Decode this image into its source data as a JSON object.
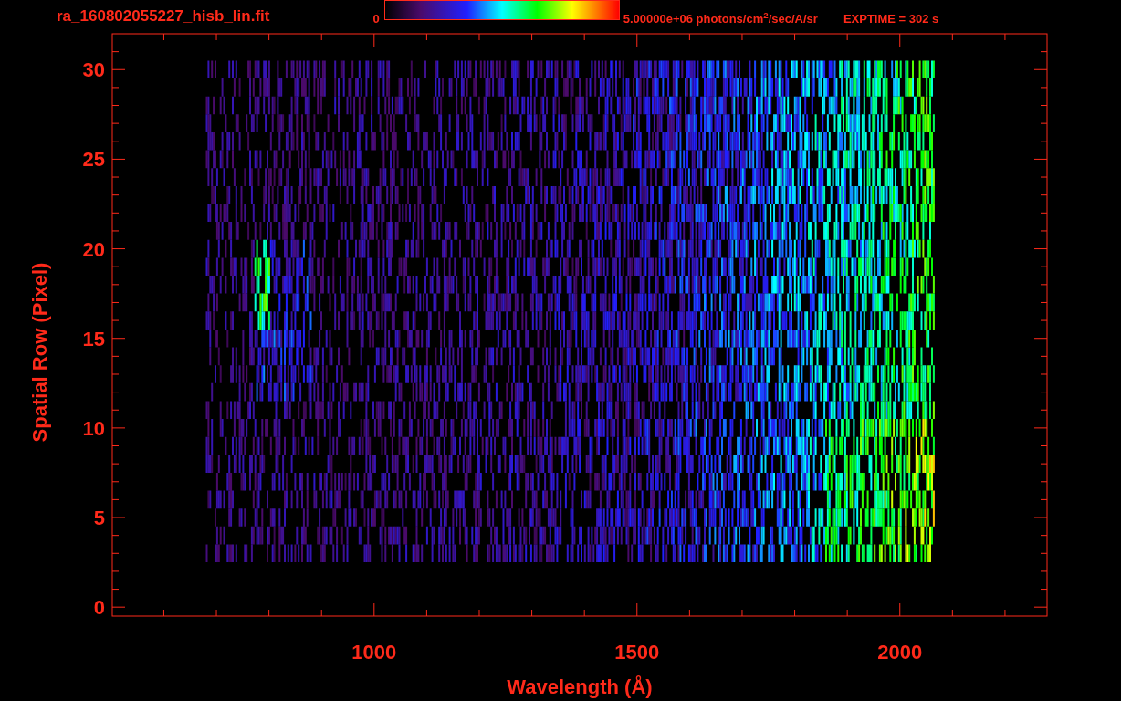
{
  "header": {
    "title": "ra_160802055227_hisb_lin.fit",
    "colorbar_min": "0",
    "colorbar_max": "5.00000e+06 photons/cm$^{2}$/sec/A/sr",
    "exposure": "EXPTIME = 302 s"
  },
  "plot": {
    "x_axis": {
      "label": "Wavelength (Å)",
      "ticks": [
        "1000",
        "1500",
        "2000"
      ]
    },
    "y_axis": {
      "label": "Spatial Row (Pixel)",
      "ticks": [
        "30",
        "25",
        "20",
        "15",
        "10",
        "5",
        "0"
      ]
    }
  }
}
